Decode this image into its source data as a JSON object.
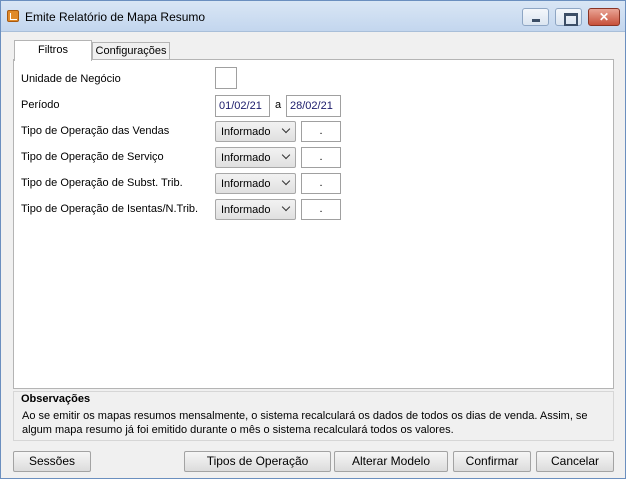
{
  "window": {
    "title": "Emite Relatório de Mapa Resumo"
  },
  "tabs": [
    {
      "label": "Filtros",
      "active": true
    },
    {
      "label": "Configurações",
      "active": false
    }
  ],
  "form": {
    "unidade_label": "Unidade de Negócio",
    "unidade_value": "",
    "periodo_label": "Período",
    "periodo_start": "01/02/21",
    "periodo_sep": "a",
    "periodo_end": "28/02/21",
    "rows": [
      {
        "label": "Tipo de Operação das Vendas",
        "select": "Informado",
        "value": "."
      },
      {
        "label": "Tipo de Operação de Serviço",
        "select": "Informado",
        "value": "."
      },
      {
        "label": "Tipo de Operação de Subst. Trib.",
        "select": "Informado",
        "value": "."
      },
      {
        "label": "Tipo de Operação de Isentas/N.Trib.",
        "select": "Informado",
        "value": "."
      }
    ]
  },
  "observacoes": {
    "title": "Observações",
    "text": "Ao se emitir os mapas resumos mensalmente, o sistema recalculará os dados de todos os dias de venda. Assim, se algum mapa resumo já foi emitido durante o mês o sistema recalculará todos os valores."
  },
  "buttons": {
    "sessoes": "Sessões",
    "tipos": "Tipos de Operação",
    "alterar": "Alterar Modelo",
    "confirmar": "Confirmar",
    "cancelar": "Cancelar"
  },
  "colors": {
    "titlebar": "#c3d6ee",
    "close": "#c7503a"
  }
}
